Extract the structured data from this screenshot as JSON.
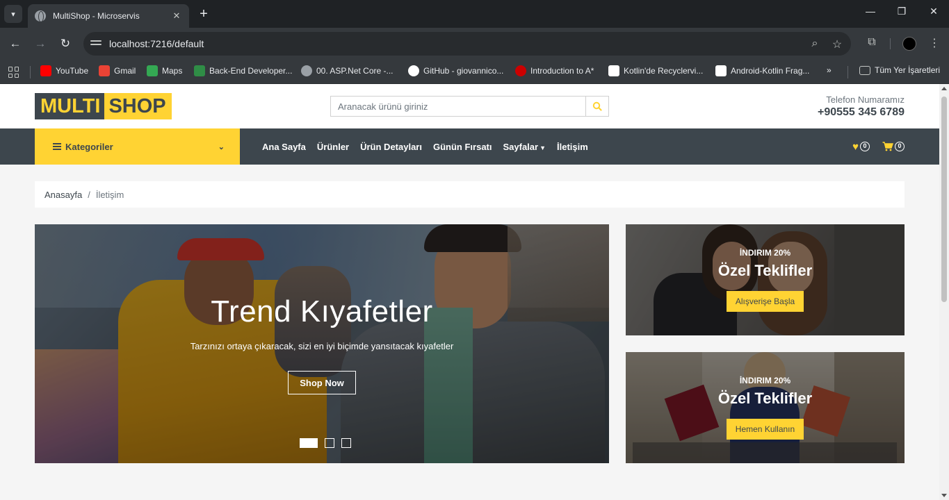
{
  "browser": {
    "tab_title": "MultiShop - Microservis",
    "url": "localhost:7216/default",
    "bookmarks": [
      {
        "label": "YouTube",
        "color": "#ff0000"
      },
      {
        "label": "Gmail",
        "color": "#ea4335"
      },
      {
        "label": "Maps",
        "color": "#34a853"
      },
      {
        "label": "Back-End Developer...",
        "color": "#2f8d46"
      },
      {
        "label": "00. ASP.Net Core -...",
        "color": "#9aa0a6"
      },
      {
        "label": "GitHub - giovannico...",
        "color": "#ffffff"
      },
      {
        "label": "Introduction to A*",
        "color": "#cc0000"
      },
      {
        "label": "Kotlin'de Recyclervi...",
        "color": "#ffffff"
      },
      {
        "label": "Android-Kotlin Frag...",
        "color": "#ffffff"
      }
    ],
    "all_bookmarks": "Tüm Yer İşaretleri"
  },
  "header": {
    "logo_part1": "MULTI",
    "logo_part2": "SHOP",
    "search_placeholder": "Aranacak ürünü giriniz",
    "phone_label": "Telefon Numaramız",
    "phone_number": "+90555 345 6789"
  },
  "nav": {
    "categories_label": "Kategoriler",
    "links": {
      "home": "Ana Sayfa",
      "products": "Ürünler",
      "product_details": "Ürün Detayları",
      "deal": "Günün Fırsatı",
      "pages": "Sayfalar",
      "contact": "İletişim"
    },
    "wishlist_count": "0",
    "cart_count": "0"
  },
  "breadcrumb": {
    "home": "Anasayfa",
    "separator": "/",
    "current": "İletişim"
  },
  "hero": {
    "title": "Trend Kıyafetler",
    "subtitle": "Tarzınızı ortaya çıkaracak, sizi en iyi biçimde yansıtacak kıyafetler",
    "button": "Shop Now",
    "active_slide": 1,
    "slide_count": 3
  },
  "offers": [
    {
      "discount": "İNDIRIM 20%",
      "title": "Özel Teklifler",
      "button": "Alışverişe Başla"
    },
    {
      "discount": "İNDIRIM 20%",
      "title": "Özel Teklifler",
      "button": "Hemen Kullanın"
    }
  ],
  "colors": {
    "accent": "#ffd333",
    "dark": "#3d464d",
    "page_bg": "#f5f5f5"
  }
}
